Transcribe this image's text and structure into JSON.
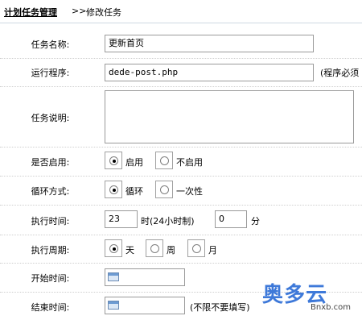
{
  "breadcrumb": {
    "section": "计划任务管理",
    "separator": ">>",
    "current": "修改任务"
  },
  "form": {
    "task_name": {
      "label": "任务名称:",
      "value": "更新首页"
    },
    "program": {
      "label": "运行程序:",
      "value": "dede-post.php",
      "note": "(程序必须"
    },
    "description": {
      "label": "任务说明:",
      "value": ""
    },
    "enabled": {
      "label": "是否启用:",
      "options": [
        "启用",
        "不启用"
      ],
      "selected": "启用"
    },
    "loop": {
      "label": "循环方式:",
      "options": [
        "循环",
        "一次性"
      ],
      "selected": "循环"
    },
    "time": {
      "label": "执行时间:",
      "hour": "23",
      "hour_suffix": "时(24小时制)",
      "minute": "0",
      "minute_suffix": "分"
    },
    "period": {
      "label": "执行周期:",
      "options": [
        "天",
        "周",
        "月"
      ],
      "selected": "天"
    },
    "start_time": {
      "label": "开始时间:",
      "value": ""
    },
    "end_time": {
      "label": "结束时间:",
      "value": "",
      "note": "(不限不要填写)"
    }
  },
  "watermark": {
    "main": "奥多云",
    "sub": "Bnxb.com"
  },
  "icons": {
    "date_picker": "calendar-icon",
    "radio": "radio-icon"
  },
  "colors": {
    "border": "#9a9a9a",
    "header_border": "#cfd8e1",
    "watermark": "#3e79d9"
  }
}
